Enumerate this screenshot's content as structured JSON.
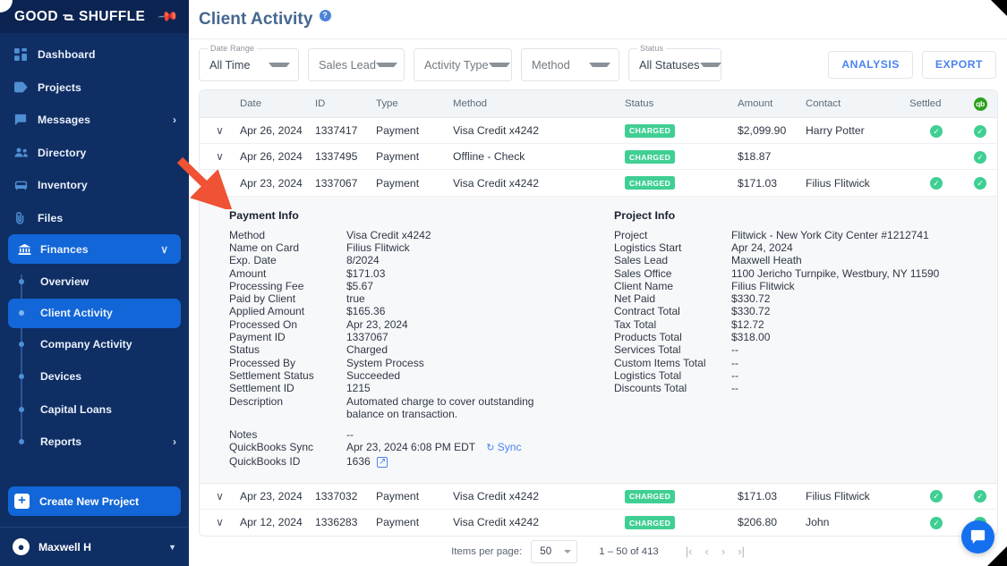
{
  "sidebar": {
    "logo": {
      "left": "GOOD",
      "right": "SHUFFLE",
      "pin_icon": "pin-icon"
    },
    "items": [
      {
        "label": "Dashboard",
        "icon": "dashboard-icon",
        "chevron": ""
      },
      {
        "label": "Projects",
        "icon": "tag-icon",
        "chevron": ""
      },
      {
        "label": "Messages",
        "icon": "message-icon",
        "chevron": "›"
      },
      {
        "label": "Directory",
        "icon": "people-icon",
        "chevron": ""
      },
      {
        "label": "Inventory",
        "icon": "sofa-icon",
        "chevron": ""
      },
      {
        "label": "Files",
        "icon": "paperclip-icon",
        "chevron": ""
      },
      {
        "label": "Finances",
        "icon": "bank-icon",
        "chevron": "∨"
      }
    ],
    "subitems": [
      {
        "label": "Overview"
      },
      {
        "label": "Client Activity"
      },
      {
        "label": "Company Activity"
      },
      {
        "label": "Devices"
      },
      {
        "label": "Capital Loans"
      },
      {
        "label": "Reports",
        "chevron": "›"
      }
    ],
    "cta": {
      "label": "Create New Project",
      "icon": "plus-icon"
    },
    "user": {
      "name": "Maxwell H",
      "icon": "person-icon",
      "caret": "▼"
    },
    "colors": {
      "bg": "#0f2e63",
      "active": "#1266d8",
      "accent": "#4f8fd4"
    }
  },
  "header": {
    "title": "Client Activity",
    "help_icon": "?"
  },
  "filters": [
    {
      "name": "date-range",
      "float_label": "Date Range",
      "value": "All Time",
      "placeholder": false
    },
    {
      "name": "sales-lead",
      "float_label": "",
      "value": "Sales Lead",
      "placeholder": true
    },
    {
      "name": "activity-type",
      "float_label": "",
      "value": "Activity Type",
      "placeholder": true
    },
    {
      "name": "method",
      "float_label": "",
      "value": "Method",
      "placeholder": true
    },
    {
      "name": "status",
      "float_label": "Status",
      "value": "All Statuses",
      "placeholder": false
    }
  ],
  "actions": {
    "analysis": "ANALYSIS",
    "export": "EXPORT"
  },
  "table": {
    "columns": [
      "Date",
      "ID",
      "Type",
      "Method",
      "Status",
      "Amount",
      "Contact",
      "Settled"
    ],
    "qb_header_icon": "qb",
    "rows": [
      {
        "expand": "∨",
        "date": "Apr 26, 2024",
        "id": "1337417",
        "type": "Payment",
        "method": "Visa Credit x4242",
        "status": "CHARGED",
        "amount": "$2,099.90",
        "contact": "Harry Potter",
        "settled": "✓",
        "qb": "✓"
      },
      {
        "expand": "∨",
        "date": "Apr 26, 2024",
        "id": "1337495",
        "type": "Payment",
        "method": "Offline - Check",
        "status": "CHARGED",
        "amount": "$18.87",
        "contact": "",
        "settled": "",
        "qb": "✓"
      },
      {
        "expand": "∧",
        "date": "Apr 23, 2024",
        "id": "1337067",
        "type": "Payment",
        "method": "Visa Credit x4242",
        "status": "CHARGED",
        "amount": "$171.03",
        "contact": "Filius Flitwick",
        "settled": "✓",
        "qb": "✓"
      },
      {
        "expand": "∨",
        "date": "Apr 23, 2024",
        "id": "1337032",
        "type": "Payment",
        "method": "Visa Credit x4242",
        "status": "CHARGED",
        "amount": "$171.03",
        "contact": "Filius Flitwick",
        "settled": "✓",
        "qb": "✓"
      },
      {
        "expand": "∨",
        "date": "Apr 12, 2024",
        "id": "1336283",
        "type": "Payment",
        "method": "Visa Credit x4242",
        "status": "CHARGED",
        "amount": "$206.80",
        "contact": "John",
        "settled": "✓",
        "qb": "✓"
      }
    ]
  },
  "detail": {
    "payment": {
      "heading": "Payment Info",
      "rows": [
        {
          "k": "Method",
          "v": "Visa Credit x4242"
        },
        {
          "k": "Name on Card",
          "v": "Filius Flitwick"
        },
        {
          "k": "Exp. Date",
          "v": "8/2024"
        },
        {
          "k": "Amount",
          "v": "$171.03"
        },
        {
          "k": "Processing Fee",
          "v": "$5.67"
        },
        {
          "k": "Paid by Client",
          "v": "true"
        },
        {
          "k": "Applied Amount",
          "v": "$165.36"
        },
        {
          "k": "Processed On",
          "v": "Apr 23, 2024"
        },
        {
          "k": "Payment ID",
          "v": "1337067"
        },
        {
          "k": "Status",
          "v": "Charged"
        },
        {
          "k": "Processed By",
          "v": "System Process"
        },
        {
          "k": "Settlement Status",
          "v": "Succeeded"
        },
        {
          "k": "Settlement ID",
          "v": "1215"
        },
        {
          "k": "Description",
          "v": "Automated charge to cover outstanding balance on transaction."
        }
      ],
      "notes_label": "Notes",
      "notes_value": "--",
      "qb_sync_label": "QuickBooks Sync",
      "qb_sync_value": "Apr 23, 2024 6:08 PM EDT",
      "qb_sync_action": "Sync",
      "qb_id_label": "QuickBooks ID",
      "qb_id_value": "1636"
    },
    "project": {
      "heading": "Project Info",
      "link_label": "Flitwick - New York City Center #1212741",
      "rows": [
        {
          "k": "Project",
          "v": ""
        },
        {
          "k": "Logistics Start",
          "v": "Apr 24, 2024"
        },
        {
          "k": "Sales Lead",
          "v": "Maxwell Heath"
        },
        {
          "k": "Sales Office",
          "v": "1100 Jericho Turnpike, Westbury, NY 11590"
        },
        {
          "k": "Client Name",
          "v": "Filius Flitwick"
        },
        {
          "k": "Net Paid",
          "v": "$330.72"
        },
        {
          "k": "Contract Total",
          "v": "$330.72"
        },
        {
          "k": "Tax Total",
          "v": "$12.72"
        },
        {
          "k": "Products Total",
          "v": "$318.00"
        },
        {
          "k": "Services Total",
          "v": "--"
        },
        {
          "k": "Custom Items Total",
          "v": "--"
        },
        {
          "k": "Logistics Total",
          "v": "--"
        },
        {
          "k": "Discounts Total",
          "v": "--"
        }
      ]
    }
  },
  "pagination": {
    "items_per_page_label": "Items per page:",
    "items_per_page_value": "50",
    "range": "1 – 50 of 413",
    "first": "|‹",
    "prev": "‹",
    "next": "›",
    "last": "›|"
  },
  "chat": {
    "icon": "chat-bubble-icon"
  },
  "annotation": {
    "arrow_color": "#ef5234"
  }
}
